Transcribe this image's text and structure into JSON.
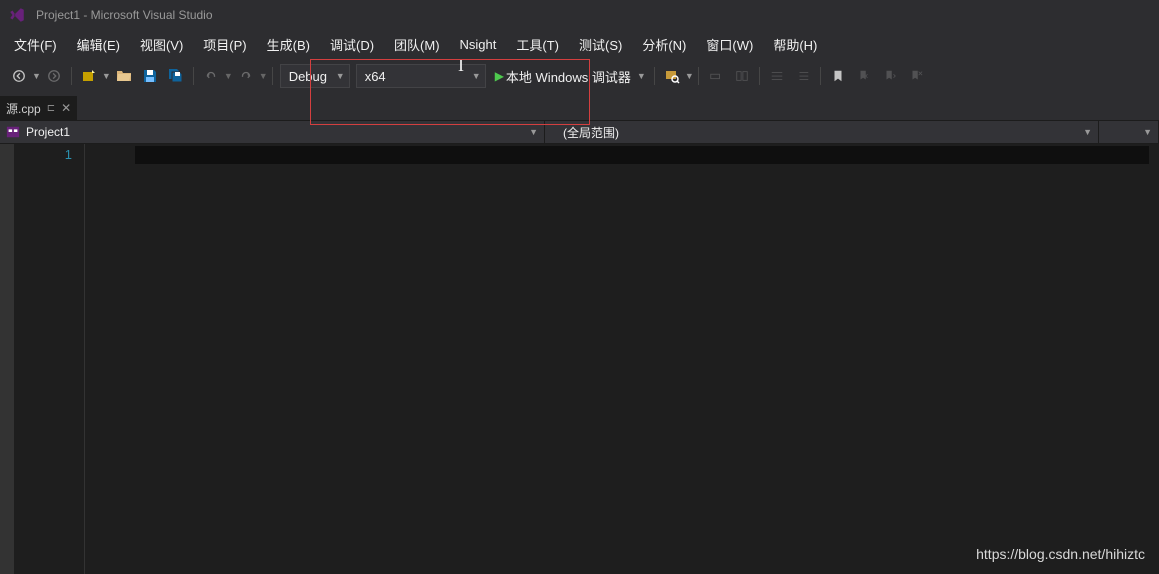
{
  "title": "Project1 - Microsoft Visual Studio",
  "menu": {
    "file": "文件(F)",
    "edit": "编辑(E)",
    "view": "视图(V)",
    "project": "项目(P)",
    "build": "生成(B)",
    "debug": "调试(D)",
    "team": "团队(M)",
    "nsight": "Nsight",
    "tools": "工具(T)",
    "test": "测试(S)",
    "analyze": "分析(N)",
    "window": "窗口(W)",
    "help": "帮助(H)"
  },
  "toolbar": {
    "config": "Debug",
    "platform": "x64",
    "debugger": "本地 Windows 调试器"
  },
  "tab": {
    "filename": "源.cpp"
  },
  "nav": {
    "project": "Project1",
    "scope": "(全局范围)"
  },
  "editor": {
    "line1": "1"
  },
  "watermark": "https://blog.csdn.net/hihiztc"
}
